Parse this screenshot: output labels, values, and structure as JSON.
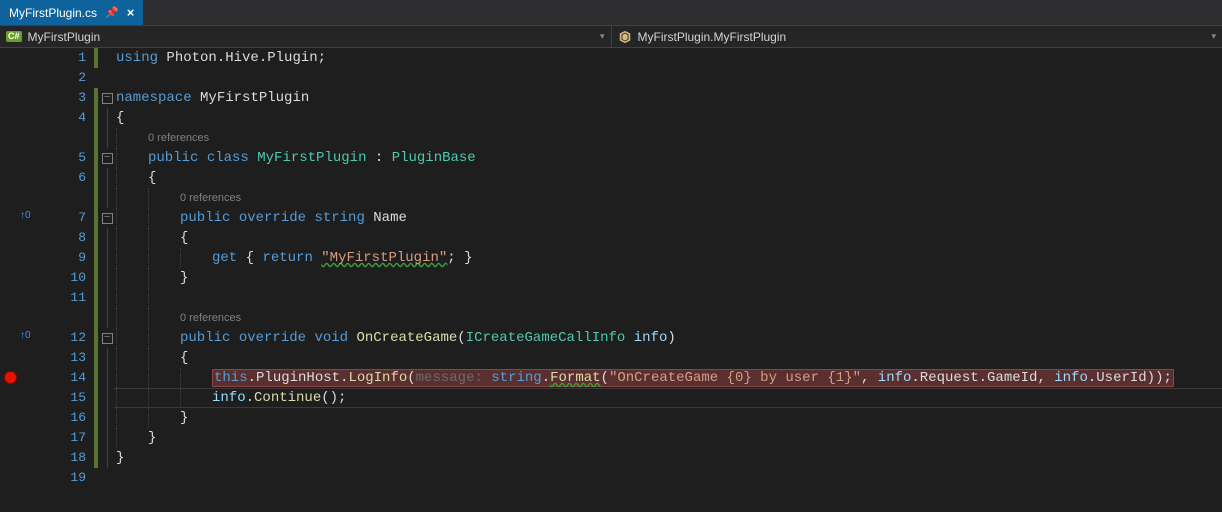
{
  "tab": {
    "filename": "MyFirstPlugin.cs",
    "pinned_glyph": "⁂",
    "close_glyph": "×"
  },
  "nav": {
    "left": {
      "text": "MyFirstPlugin"
    },
    "right": {
      "text": "MyFirstPlugin.MyFirstPlugin"
    }
  },
  "markers": {
    "line7": {
      "glyph": "↑",
      "count": "0"
    },
    "line12": {
      "glyph": "↑",
      "count": "0"
    }
  },
  "codelens": {
    "class": "0 references",
    "prop": "0 references",
    "method": "0 references"
  },
  "fold": {
    "minus": "−"
  },
  "code": {
    "l1": {
      "using": "using",
      "ns": "Photon.Hive.Plugin",
      "semi": ";"
    },
    "l3": {
      "namespace": "namespace",
      "name": "MyFirstPlugin"
    },
    "l4": {
      "brace": "{"
    },
    "l5": {
      "public": "public",
      "class": "class",
      "name": "MyFirstPlugin",
      "colon": " : ",
      "base": "PluginBase"
    },
    "l6": {
      "brace": "{"
    },
    "l7": {
      "public": "public",
      "override": "override",
      "type": "string",
      "name": "Name"
    },
    "l8": {
      "brace": "{"
    },
    "l9": {
      "get": "get",
      "ob": " { ",
      "return": "return",
      "str": "\"MyFirstPlugin\"",
      "cb": "; }"
    },
    "l10": {
      "brace": "}"
    },
    "l12": {
      "public": "public",
      "override": "override",
      "void": "void",
      "name": "OnCreateGame",
      "op": "(",
      "ptype": "ICreateGameCallInfo",
      "pname": "info",
      "cp": ")"
    },
    "l13": {
      "brace": "{"
    },
    "l14": {
      "this": "this",
      "dot1": ".",
      "ph": "PluginHost",
      "dot2": ".",
      "li": "LogInfo",
      "op": "(",
      "hint": "message:",
      "sp": " ",
      "stringT": "string",
      "dot3": ".",
      "fmt": "Format",
      "op2": "(",
      "str": "\"OnCreateGame {0} by user {1}\"",
      "c1": ", ",
      "a1a": "info",
      "a1b": ".Request.GameId",
      "c2": ", ",
      "a2a": "info",
      "a2b": ".UserId",
      "cp": "));"
    },
    "l15": {
      "info": "info",
      "dot": ".",
      "cont": "Continue",
      "par": "();"
    },
    "l16": {
      "brace": "}"
    },
    "l17": {
      "brace": "}"
    },
    "l18": {
      "brace": "}"
    }
  },
  "linenumbers": [
    "1",
    "2",
    "3",
    "4",
    "5",
    "6",
    "7",
    "8",
    "9",
    "10",
    "11",
    "12",
    "13",
    "14",
    "15",
    "16",
    "17",
    "18",
    "19"
  ]
}
